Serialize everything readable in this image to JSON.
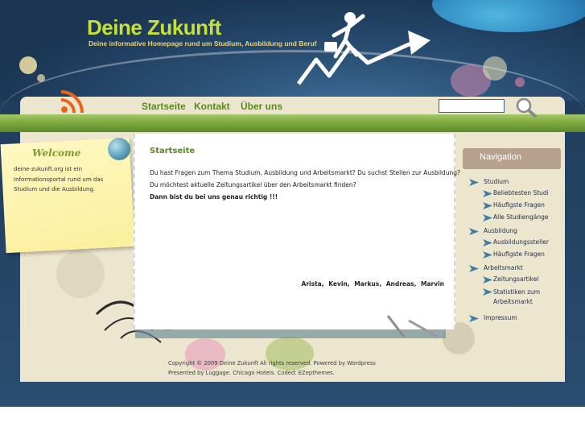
{
  "header": {
    "title": "Deine Zukunft",
    "subtitle": "Deine informative Homepage rund um Studium, Ausbildung und Beruf"
  },
  "nav": {
    "items": [
      "Startseite",
      "Kontakt",
      "Über uns"
    ]
  },
  "search": {
    "value": ""
  },
  "welcome": {
    "title": "Welcome",
    "text": "deine-zukunft.org ist ein Informationsportal rund um das Studium und die Ausbildung."
  },
  "main": {
    "title": "Startseite",
    "line1": "Du hast Fragen zum Thema Studium, Ausbildung und Arbeitsmarkt? Du suchst Stellen zur Ausbildung?",
    "line2": "Du möchtest aktuelle Zeitungsartikel über den Arbeitsmarkt finden?",
    "line3": "Dann bist du bei uns genau richtig !!!",
    "signature": "Arista, Kevin, Markus, Andreas, Marvin"
  },
  "sidebar": {
    "heading": "Navigation",
    "items": [
      {
        "label": "Studium",
        "level": 1
      },
      {
        "label": "Beliebtesten Studien",
        "level": 2
      },
      {
        "label": "Häufigste Fragen",
        "level": 2
      },
      {
        "label": "Alle Studiengänge A-Z",
        "level": 2
      },
      {
        "label": "Ausbildung",
        "level": 1
      },
      {
        "label": "Ausbildungsstellen",
        "level": 2
      },
      {
        "label": "Häufigste Fragen",
        "level": 2
      },
      {
        "label": "Arbeitsmarkt",
        "level": 1
      },
      {
        "label": "Zeitungsartikel",
        "level": 2
      },
      {
        "label": "Statistiken zum Arbeitsmarkt",
        "level": 2
      },
      {
        "label": "Impressum",
        "level": 1
      }
    ]
  },
  "footer": {
    "line1": "Copyright © 2009 Deine Zukunft All rights reserved. Powered by Wordpress",
    "line2": "Presented by Luggage. Chicago Hotels. Coded: EZepthemes."
  },
  "colors": {
    "accent_green": "#5a8a1e",
    "title_green": "#c6e03a",
    "sidebar_head": "#b6a28c"
  }
}
